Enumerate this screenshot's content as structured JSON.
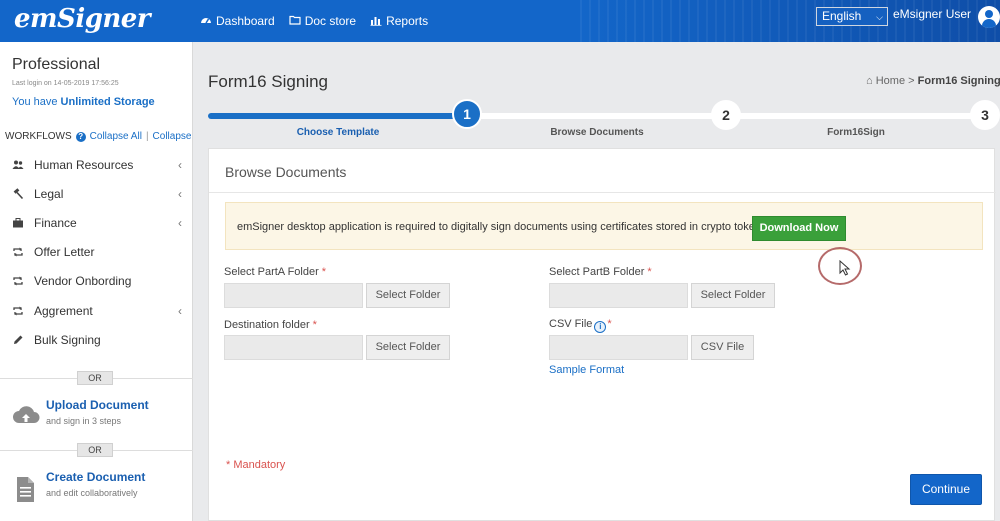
{
  "header": {
    "logo": "emSigner",
    "nav": [
      {
        "label": "Dashboard",
        "icon": "dashboard-icon"
      },
      {
        "label": "Doc store",
        "icon": "folder-icon"
      },
      {
        "label": "Reports",
        "icon": "bar-chart-icon"
      }
    ],
    "language": "English",
    "user_name": "eMsigner User"
  },
  "sidebar": {
    "plan": "Professional",
    "last_login": "Last login on 14-05-2019 17:56:25",
    "storage_prefix": "You have",
    "storage_value": "Unlimited Storage",
    "workflows_label": "WORKFLOWS",
    "collapse_all": "Collapse All",
    "separator": "|",
    "collapse": "Collapse",
    "items": [
      {
        "label": "Human Resources",
        "icon": "users-icon",
        "chevron": "‹"
      },
      {
        "label": "Legal",
        "icon": "gavel-icon",
        "chevron": "‹"
      },
      {
        "label": "Finance",
        "icon": "briefcase-icon",
        "chevron": "‹"
      },
      {
        "label": "Offer Letter",
        "icon": "retweet-icon",
        "chevron": ""
      },
      {
        "label": "Vendor Onbording",
        "icon": "retweet-icon",
        "chevron": ""
      },
      {
        "label": "Aggrement",
        "icon": "retweet-icon",
        "chevron": "‹"
      },
      {
        "label": "Bulk Signing",
        "icon": "pencil-icon",
        "chevron": ""
      }
    ],
    "or_label": "OR",
    "upload": {
      "title": "Upload Document",
      "subtitle": "and sign in 3 steps"
    },
    "create": {
      "title": "Create Document",
      "subtitle": "and edit collaboratively"
    }
  },
  "main": {
    "title": "Form16 Signing",
    "breadcrumb": {
      "home": "Home",
      "sep": ">",
      "current": "Form16 Signing"
    },
    "steps": [
      {
        "num": "1",
        "label": "Choose Template",
        "active": true
      },
      {
        "num": "2",
        "label": "Browse Documents",
        "active": false
      },
      {
        "num": "3",
        "label": "Form16Sign",
        "active": false
      }
    ],
    "progress_fraction": 0.33,
    "card_title": "Browse Documents",
    "alert_text": "emSigner desktop application is required to digitally sign documents using certificates stored in crypto tokens",
    "download_label": "Download Now",
    "fields": {
      "partA": {
        "label": "Select PartA Folder",
        "button": "Select Folder"
      },
      "partB": {
        "label": "Select PartB Folder",
        "button": "Select Folder"
      },
      "dest": {
        "label": "Destination folder",
        "button": "Select Folder"
      },
      "csv": {
        "label": "CSV File",
        "button": "CSV File",
        "info": "i"
      }
    },
    "required_mark": "*",
    "sample_format": "Sample Format",
    "mandatory_note": "* Mandatory",
    "continue_label": "Continue"
  },
  "colors": {
    "primary": "#1366c9",
    "success": "#3aa03a",
    "required": "#d9534f"
  }
}
